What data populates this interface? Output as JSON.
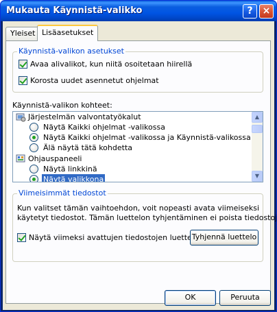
{
  "window": {
    "title": "Mukauta Käynnistä-valikko",
    "help_glyph": "?",
    "close_glyph": "×"
  },
  "tabs": [
    {
      "label": "Yleiset",
      "active": false
    },
    {
      "label": "Lisäasetukset",
      "active": true
    }
  ],
  "start_menu_settings": {
    "title": "Käynnistä-valikon asetukset",
    "options": [
      {
        "label": "Avaa alivalikot, kun niitä osoitetaan hiirellä",
        "checked": true
      },
      {
        "label": "Korosta uudet asennetut ohjelmat",
        "checked": true
      }
    ]
  },
  "items_section": {
    "label": "Käynnistä-valikon kohteet:",
    "list": [
      {
        "type": "category",
        "icon": "admin-tools-icon",
        "label": "Järjestelmän valvontatyökalut"
      },
      {
        "type": "radio",
        "label": "Näytä Kaikki ohjelmat -valikossa",
        "selected": false
      },
      {
        "type": "radio",
        "label": "Näytä Kaikki ohjelmat -valikossa ja Käynnistä-valikossa",
        "selected": true
      },
      {
        "type": "radio",
        "label": "Älä näytä tätä kohdetta",
        "selected": false
      },
      {
        "type": "category",
        "icon": "control-panel-icon",
        "label": "Ohjauspaneeli"
      },
      {
        "type": "radio",
        "label": "Näytä linkkinä",
        "selected": false
      },
      {
        "type": "radio",
        "label": "Näytä valikkona",
        "selected": true,
        "highlighted": true
      }
    ],
    "scroll": {
      "up_glyph": "▲",
      "down_glyph": "▼"
    }
  },
  "recent_documents": {
    "title": "Viimeisimmät tiedostot",
    "description_line1": "Kun valitset tämän vaihtoehdon, voit nopeasti avata viimeiseksi",
    "description_line2": "käytetyt tiedostot. Tämän luettelon tyhjentäminen ei poista tiedostoja.",
    "checkbox_label": "Näytä viimeksi avattujen tiedostojen luettelo",
    "checked": true,
    "clear_button": "Tyhjennä luettelo"
  },
  "buttons": {
    "ok": "OK",
    "cancel": "Peruuta"
  },
  "colors": {
    "title_bar": "#0054e3",
    "group_title": "#0046d5",
    "selection": "#316ac5",
    "checkmark": "#21a121"
  }
}
